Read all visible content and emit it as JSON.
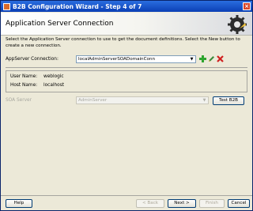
{
  "window": {
    "title": "B2B Configuration Wizard - Step 4 of 7",
    "close": "×"
  },
  "header": {
    "title": "Application Server Connection"
  },
  "description": "Select the Application Server connection to use to get the document definitions. Select the New button to create a new connection.",
  "appserver": {
    "label": "AppServer Connection:",
    "value": "localAdminServerSOADomainConn"
  },
  "info": {
    "user_label": "User Name:",
    "user_value": "weblogic",
    "host_label": "Host Name:",
    "host_value": "localhost"
  },
  "soa": {
    "label": "SOA Server",
    "value": "AdminServer",
    "test_button": "Test B2B"
  },
  "icons": {
    "add": "plus-icon",
    "edit": "pencil-icon",
    "delete": "x-icon",
    "arrow": "▼"
  },
  "buttons": {
    "help": "Help",
    "back": "< Back",
    "next": "Next >",
    "finish": "Finish",
    "cancel": "Cancel"
  },
  "colors": {
    "title_bar": "#0b3fb5",
    "add": "#2fa52f",
    "delete": "#d02020"
  }
}
